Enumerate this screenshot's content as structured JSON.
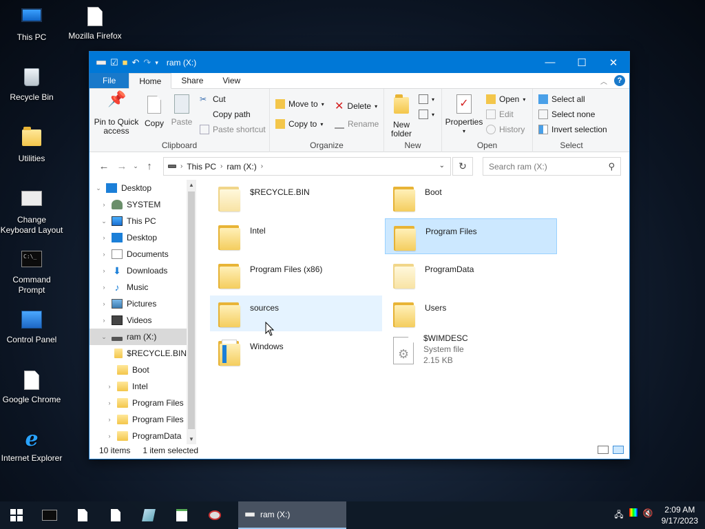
{
  "desktop": {
    "icons": [
      {
        "label": "This PC",
        "icon": "this-pc-icon"
      },
      {
        "label": "Mozilla Firefox",
        "icon": "file-icon"
      },
      {
        "label": "Recycle Bin",
        "icon": "recycle-bin-icon"
      },
      {
        "label": "Utilities",
        "icon": "folder-icon"
      },
      {
        "label": "Change Keyboard Layout",
        "icon": "keyboard-icon"
      },
      {
        "label": "Command Prompt",
        "icon": "cmd-icon"
      },
      {
        "label": "Control Panel",
        "icon": "control-panel-icon"
      },
      {
        "label": "Google Chrome",
        "icon": "file-icon"
      },
      {
        "label": "Internet Explorer",
        "icon": "ie-icon"
      }
    ]
  },
  "window": {
    "title": "ram (X:)",
    "tabs": {
      "file": "File",
      "home": "Home",
      "share": "Share",
      "view": "View"
    },
    "ribbon": {
      "clipboard": {
        "label": "Clipboard",
        "pin": "Pin to Quick access",
        "copy": "Copy",
        "paste": "Paste",
        "cut": "Cut",
        "copy_path": "Copy path",
        "paste_shortcut": "Paste shortcut"
      },
      "organize": {
        "label": "Organize",
        "move_to": "Move to",
        "copy_to": "Copy to",
        "delete": "Delete",
        "rename": "Rename"
      },
      "new": {
        "label": "New",
        "new_folder": "New folder"
      },
      "open": {
        "label": "Open",
        "properties": "Properties",
        "open": "Open",
        "edit": "Edit",
        "history": "History"
      },
      "select": {
        "label": "Select",
        "select_all": "Select all",
        "select_none": "Select none",
        "invert": "Invert selection"
      }
    },
    "address": {
      "crumbs": [
        "This PC",
        "ram (X:)"
      ],
      "search_placeholder": "Search ram (X:)"
    },
    "tree": [
      {
        "label": "Desktop",
        "depth": 0,
        "icon": "t-blue",
        "chev": "v"
      },
      {
        "label": "SYSTEM",
        "depth": 1,
        "icon": "t-user",
        "chev": ">"
      },
      {
        "label": "This PC",
        "depth": 1,
        "icon": "t-pc",
        "chev": "v"
      },
      {
        "label": "Desktop",
        "depth": 2,
        "icon": "t-blue",
        "chev": ">"
      },
      {
        "label": "Documents",
        "depth": 2,
        "icon": "t-doc",
        "chev": ">"
      },
      {
        "label": "Downloads",
        "depth": 2,
        "icon": "t-down",
        "chev": ">"
      },
      {
        "label": "Music",
        "depth": 2,
        "icon": "t-music",
        "chev": ">"
      },
      {
        "label": "Pictures",
        "depth": 2,
        "icon": "t-pic",
        "chev": ">"
      },
      {
        "label": "Videos",
        "depth": 2,
        "icon": "t-vid",
        "chev": ">"
      },
      {
        "label": "ram (X:)",
        "depth": 2,
        "icon": "t-drive",
        "chev": "v",
        "selected": true
      },
      {
        "label": "$RECYCLE.BIN",
        "depth": 3,
        "icon": "t-folder",
        "chev": ""
      },
      {
        "label": "Boot",
        "depth": 3,
        "icon": "t-folder",
        "chev": ""
      },
      {
        "label": "Intel",
        "depth": 3,
        "icon": "t-folder",
        "chev": ">"
      },
      {
        "label": "Program Files",
        "depth": 3,
        "icon": "t-folder",
        "chev": ">"
      },
      {
        "label": "Program Files",
        "depth": 3,
        "icon": "t-folder",
        "chev": ">"
      },
      {
        "label": "ProgramData",
        "depth": 3,
        "icon": "t-folder",
        "chev": ">"
      }
    ],
    "files": [
      {
        "name": "$RECYCLE.BIN",
        "kind": "folder-faded"
      },
      {
        "name": "Boot",
        "kind": "folder"
      },
      {
        "name": "Intel",
        "kind": "folder"
      },
      {
        "name": "Program Files",
        "kind": "folder",
        "selected": true
      },
      {
        "name": "Program Files (x86)",
        "kind": "folder"
      },
      {
        "name": "ProgramData",
        "kind": "folder-faded"
      },
      {
        "name": "sources",
        "kind": "folder",
        "hover": true
      },
      {
        "name": "Users",
        "kind": "folder"
      },
      {
        "name": "Windows",
        "kind": "folder-windows"
      },
      {
        "name": "$WIMDESC",
        "kind": "sysfile",
        "type": "System file",
        "size": "2.15 KB"
      }
    ],
    "status": {
      "count": "10 items",
      "selection": "1 item selected"
    }
  },
  "taskbar": {
    "active_app": "ram (X:)",
    "time": "2:09 AM",
    "date": "9/17/2023"
  }
}
